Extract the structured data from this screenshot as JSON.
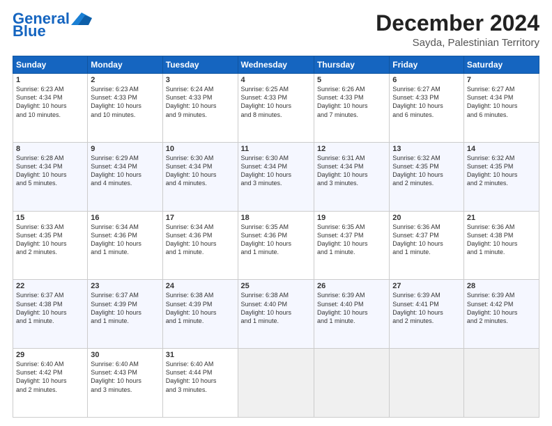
{
  "logo": {
    "line1": "General",
    "line2": "Blue"
  },
  "header": {
    "month_year": "December 2024",
    "location": "Sayda, Palestinian Territory"
  },
  "weekdays": [
    "Sunday",
    "Monday",
    "Tuesday",
    "Wednesday",
    "Thursday",
    "Friday",
    "Saturday"
  ],
  "weeks": [
    [
      {
        "day": "1",
        "sunrise": "6:23 AM",
        "sunset": "4:34 PM",
        "daylight": "10 hours and 10 minutes."
      },
      {
        "day": "2",
        "sunrise": "6:23 AM",
        "sunset": "4:33 PM",
        "daylight": "10 hours and 10 minutes."
      },
      {
        "day": "3",
        "sunrise": "6:24 AM",
        "sunset": "4:33 PM",
        "daylight": "10 hours and 9 minutes."
      },
      {
        "day": "4",
        "sunrise": "6:25 AM",
        "sunset": "4:33 PM",
        "daylight": "10 hours and 8 minutes."
      },
      {
        "day": "5",
        "sunrise": "6:26 AM",
        "sunset": "4:33 PM",
        "daylight": "10 hours and 7 minutes."
      },
      {
        "day": "6",
        "sunrise": "6:27 AM",
        "sunset": "4:33 PM",
        "daylight": "10 hours and 6 minutes."
      },
      {
        "day": "7",
        "sunrise": "6:27 AM",
        "sunset": "4:34 PM",
        "daylight": "10 hours and 6 minutes."
      }
    ],
    [
      {
        "day": "8",
        "sunrise": "6:28 AM",
        "sunset": "4:34 PM",
        "daylight": "10 hours and 5 minutes."
      },
      {
        "day": "9",
        "sunrise": "6:29 AM",
        "sunset": "4:34 PM",
        "daylight": "10 hours and 4 minutes."
      },
      {
        "day": "10",
        "sunrise": "6:30 AM",
        "sunset": "4:34 PM",
        "daylight": "10 hours and 4 minutes."
      },
      {
        "day": "11",
        "sunrise": "6:30 AM",
        "sunset": "4:34 PM",
        "daylight": "10 hours and 3 minutes."
      },
      {
        "day": "12",
        "sunrise": "6:31 AM",
        "sunset": "4:34 PM",
        "daylight": "10 hours and 3 minutes."
      },
      {
        "day": "13",
        "sunrise": "6:32 AM",
        "sunset": "4:35 PM",
        "daylight": "10 hours and 2 minutes."
      },
      {
        "day": "14",
        "sunrise": "6:32 AM",
        "sunset": "4:35 PM",
        "daylight": "10 hours and 2 minutes."
      }
    ],
    [
      {
        "day": "15",
        "sunrise": "6:33 AM",
        "sunset": "4:35 PM",
        "daylight": "10 hours and 2 minutes."
      },
      {
        "day": "16",
        "sunrise": "6:34 AM",
        "sunset": "4:36 PM",
        "daylight": "10 hours and 1 minute."
      },
      {
        "day": "17",
        "sunrise": "6:34 AM",
        "sunset": "4:36 PM",
        "daylight": "10 hours and 1 minute."
      },
      {
        "day": "18",
        "sunrise": "6:35 AM",
        "sunset": "4:36 PM",
        "daylight": "10 hours and 1 minute."
      },
      {
        "day": "19",
        "sunrise": "6:35 AM",
        "sunset": "4:37 PM",
        "daylight": "10 hours and 1 minute."
      },
      {
        "day": "20",
        "sunrise": "6:36 AM",
        "sunset": "4:37 PM",
        "daylight": "10 hours and 1 minute."
      },
      {
        "day": "21",
        "sunrise": "6:36 AM",
        "sunset": "4:38 PM",
        "daylight": "10 hours and 1 minute."
      }
    ],
    [
      {
        "day": "22",
        "sunrise": "6:37 AM",
        "sunset": "4:38 PM",
        "daylight": "10 hours and 1 minute."
      },
      {
        "day": "23",
        "sunrise": "6:37 AM",
        "sunset": "4:39 PM",
        "daylight": "10 hours and 1 minute."
      },
      {
        "day": "24",
        "sunrise": "6:38 AM",
        "sunset": "4:39 PM",
        "daylight": "10 hours and 1 minute."
      },
      {
        "day": "25",
        "sunrise": "6:38 AM",
        "sunset": "4:40 PM",
        "daylight": "10 hours and 1 minute."
      },
      {
        "day": "26",
        "sunrise": "6:39 AM",
        "sunset": "4:40 PM",
        "daylight": "10 hours and 1 minute."
      },
      {
        "day": "27",
        "sunrise": "6:39 AM",
        "sunset": "4:41 PM",
        "daylight": "10 hours and 2 minutes."
      },
      {
        "day": "28",
        "sunrise": "6:39 AM",
        "sunset": "4:42 PM",
        "daylight": "10 hours and 2 minutes."
      }
    ],
    [
      {
        "day": "29",
        "sunrise": "6:40 AM",
        "sunset": "4:42 PM",
        "daylight": "10 hours and 2 minutes."
      },
      {
        "day": "30",
        "sunrise": "6:40 AM",
        "sunset": "4:43 PM",
        "daylight": "10 hours and 3 minutes."
      },
      {
        "day": "31",
        "sunrise": "6:40 AM",
        "sunset": "4:44 PM",
        "daylight": "10 hours and 3 minutes."
      },
      null,
      null,
      null,
      null
    ]
  ]
}
